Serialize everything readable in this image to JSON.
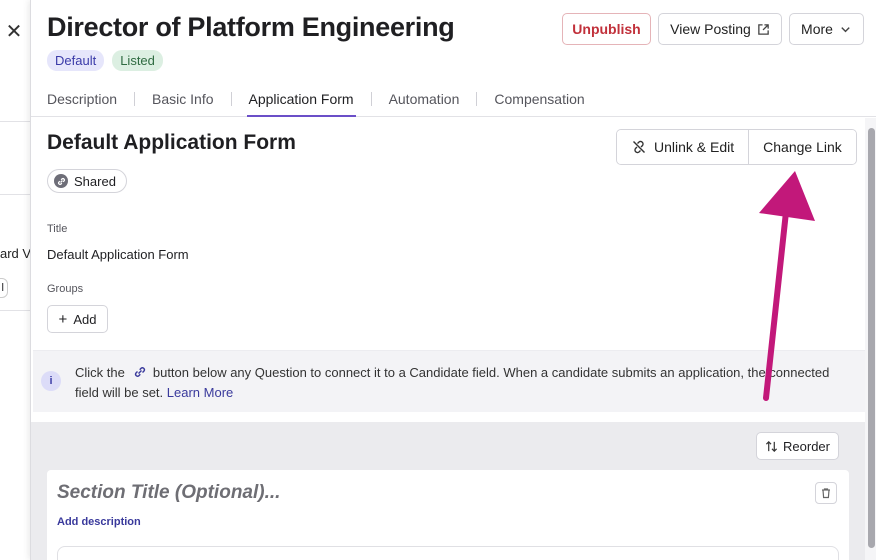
{
  "background": {
    "fragment_text": "ard Vi",
    "chip_text": "l"
  },
  "header": {
    "title": "Director of Platform Engineering",
    "badges": [
      "Default",
      "Listed"
    ],
    "buttons": {
      "unpublish": "Unpublish",
      "view_posting": "View Posting",
      "more": "More"
    },
    "tabs": [
      "Description",
      "Basic Info",
      "Application Form",
      "Automation",
      "Compensation"
    ],
    "active_tab": "Application Form"
  },
  "form": {
    "title": "Default Application Form",
    "shared_label": "Shared",
    "unlink_edit": "Unlink & Edit",
    "change_link": "Change Link",
    "title_label": "Title",
    "title_value": "Default Application Form",
    "groups_label": "Groups",
    "add_label": "Add"
  },
  "info": {
    "text_before": "Click the",
    "text_after": "button below any Question to connect it to a Candidate field. When a candidate submits an application, the connected field will be set.",
    "learn_more": "Learn More"
  },
  "section": {
    "reorder": "Reorder",
    "title_placeholder": "Section Title (Optional)...",
    "add_description": "Add description"
  },
  "colors": {
    "accent": "#6b4fc8",
    "annotation_arrow": "#c2187a",
    "danger": "#c1303a"
  }
}
